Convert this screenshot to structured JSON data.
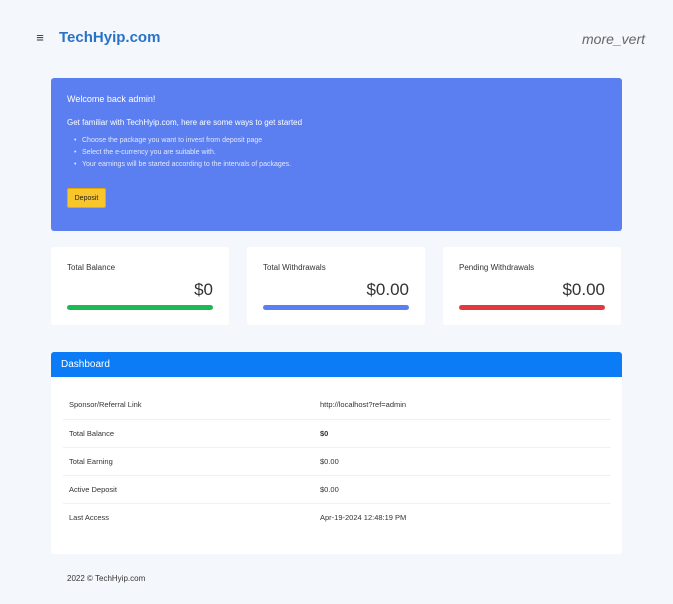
{
  "header": {
    "brand": "TechHyip.com",
    "menu_icon": "≡",
    "more_vert": "more_vert"
  },
  "welcome": {
    "title": "Welcome back admin!",
    "intro": "Get familiar with TechHyip.com, here are some ways to get started",
    "items": [
      "Choose the package you want to invest from deposit page",
      "Select the e-currency you are suitable with.",
      "Your earnings will be started according to the intervals of packages."
    ],
    "deposit_label": "Deposit"
  },
  "stats": [
    {
      "label": "Total Balance",
      "value": "$0",
      "color": "#1db954"
    },
    {
      "label": "Total Withdrawals",
      "value": "$0.00",
      "color": "#5b7ff0"
    },
    {
      "label": "Pending Withdrawals",
      "value": "$0.00",
      "color": "#e03a3e"
    }
  ],
  "dashboard": {
    "title": "Dashboard",
    "rows": [
      {
        "key": "Sponsor/Referral Link",
        "value": "http://localhost?ref=admin"
      },
      {
        "key": "Total Balance",
        "value": "$0"
      },
      {
        "key": "Total Earning",
        "value": "$0.00"
      },
      {
        "key": "Active Deposit",
        "value": "$0.00"
      },
      {
        "key": "Last Access",
        "value": "Apr-19-2024 12:48:19 PM"
      }
    ]
  },
  "footer": {
    "text": "2022 © TechHyip.com"
  },
  "colors": {
    "brand": "#2a72c6",
    "welcome_bg": "#5b7ff0",
    "panel_head": "#0b7bf6",
    "deposit_btn": "#f8c62b"
  }
}
